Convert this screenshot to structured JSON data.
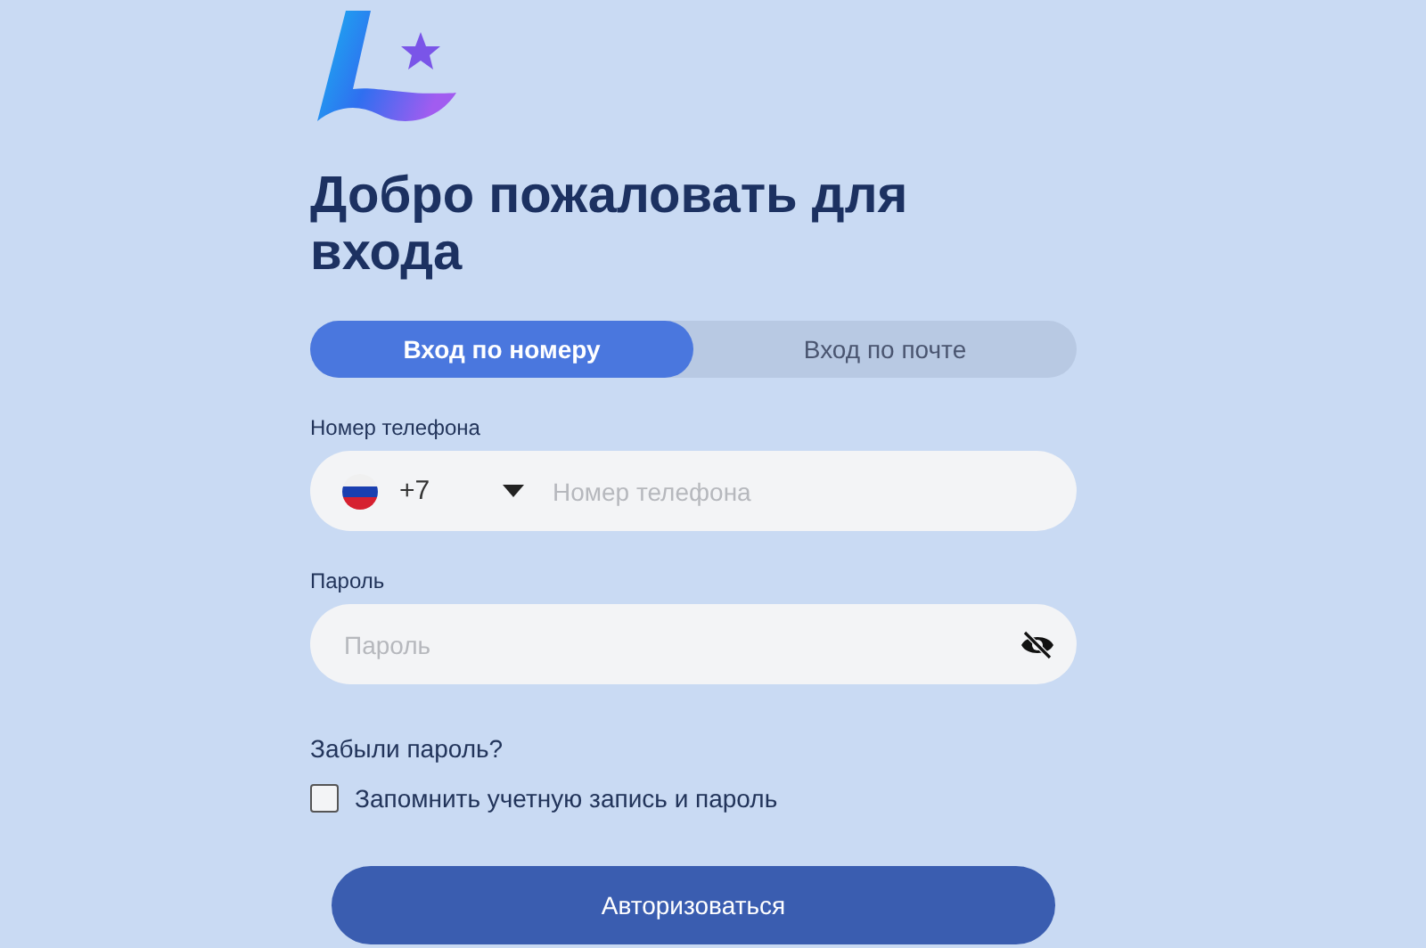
{
  "title": "Добро пожаловать для входа",
  "tabs": [
    {
      "label": "Вход по номеру",
      "selected": true
    },
    {
      "label": "Вход по почте",
      "selected": false
    }
  ],
  "phone": {
    "label": "Номер телефона",
    "code": "+7",
    "placeholder": "Номер телефона"
  },
  "password": {
    "label": "Пароль",
    "placeholder": "Пароль"
  },
  "forgot_link": "Забыли пароль?",
  "remember": {
    "label": "Запомнить учетную запись и пароль",
    "checked": false
  },
  "submit": "Авторизоваться"
}
